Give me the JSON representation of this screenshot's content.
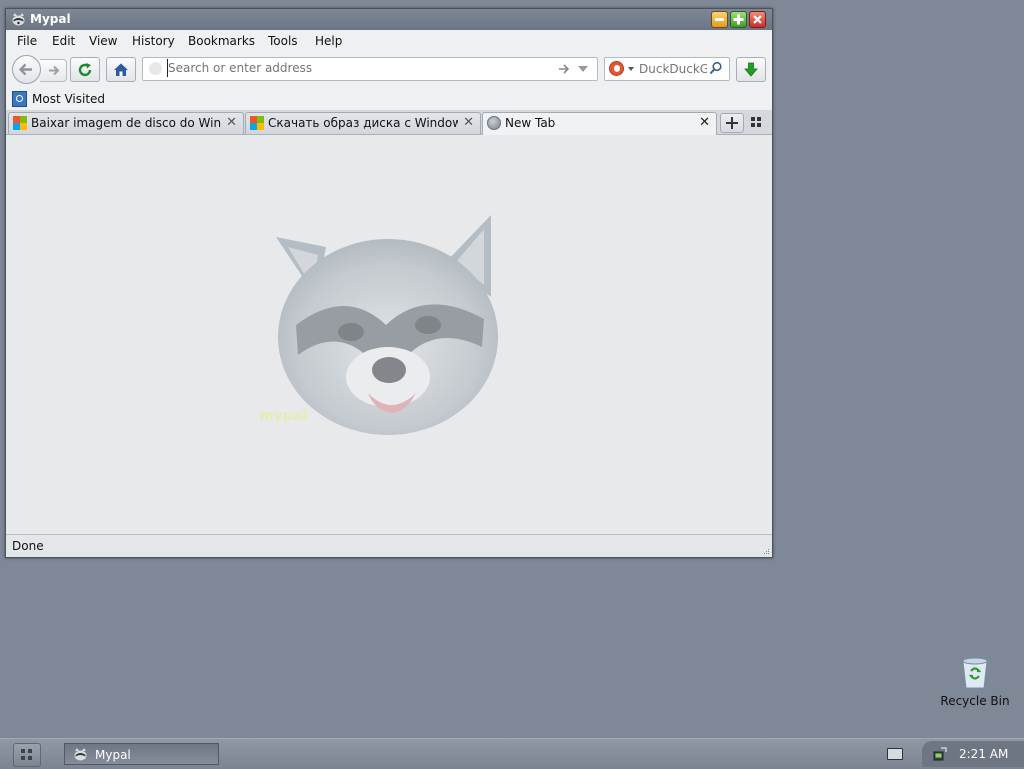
{
  "window": {
    "title": "Mypal"
  },
  "menu": {
    "items": [
      "File",
      "Edit",
      "View",
      "History",
      "Bookmarks",
      "Tools",
      "Help"
    ]
  },
  "navbar": {
    "url_placeholder": "Search or enter address",
    "url_value": "",
    "search_engine": "DuckDuckGo",
    "search_placeholder": "DuckDuckGo"
  },
  "bookmarks": {
    "most_visited": "Most Visited"
  },
  "tabs": [
    {
      "label": "Baixar imagem de disco do Win...",
      "icon": "windows-logo-icon",
      "active": false
    },
    {
      "label": "Скачать образ диска с Window...",
      "icon": "windows-logo-icon",
      "active": false
    },
    {
      "label": "New Tab",
      "icon": "globe-icon",
      "active": true
    }
  ],
  "status": {
    "text": "Done"
  },
  "desktop": {
    "recycle_bin_label": "Recycle Bin"
  },
  "taskbar": {
    "task_label": "Mypal",
    "clock": "2:21 AM"
  },
  "colors": {
    "desktop_bg": "#7f8896",
    "titlebar": "#6b7584",
    "close_button": "#c9302a",
    "download_arrow": "#1fa01f"
  }
}
